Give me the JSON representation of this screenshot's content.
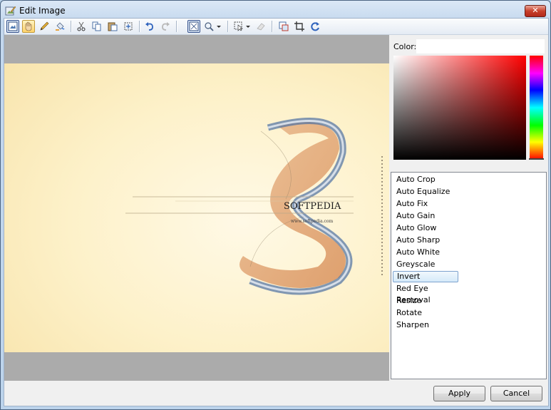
{
  "window": {
    "title": "Edit Image",
    "close_glyph": "✕"
  },
  "toolbar": {
    "icons": [
      "fit-to-window-icon",
      "hand-pan-icon",
      "pencil-icon",
      "fill-bucket-icon",
      "cut-icon",
      "copy-icon",
      "paste-icon",
      "select-all-icon",
      "undo-icon",
      "redo-icon",
      "actual-size-icon",
      "zoom-icon",
      "selection-tool-icon",
      "eraser-icon",
      "resize-canvas-icon",
      "crop-icon",
      "refresh-icon"
    ]
  },
  "canvas": {
    "image_text": "SOFTPEDIA",
    "image_subtext": "www.softpedia.com"
  },
  "color_panel": {
    "label": "Color:",
    "value": "",
    "hue": "red",
    "color": "#ff0000"
  },
  "effects_list": {
    "items": [
      "Auto Crop",
      "Auto Equalize",
      "Auto Fix",
      "Auto Gain",
      "Auto Glow",
      "Auto Sharp",
      "Auto White",
      "Greyscale",
      "Invert",
      "Red Eye Removal",
      "Resize",
      "Rotate",
      "Sharpen"
    ],
    "selected": "Invert"
  },
  "buttons": {
    "apply": "Apply",
    "cancel": "Cancel"
  }
}
